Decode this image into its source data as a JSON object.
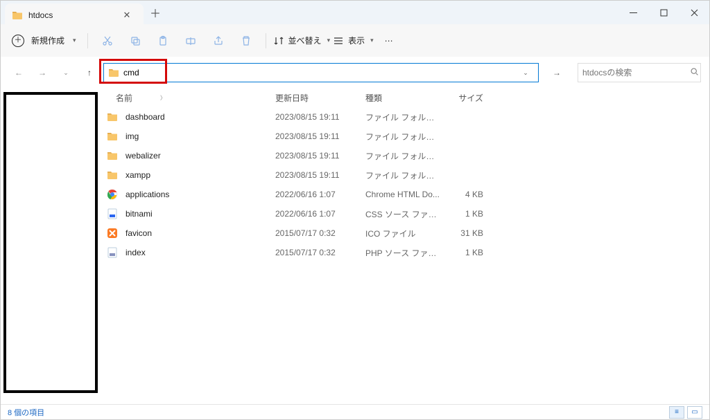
{
  "window": {
    "tab_title": "htdocs"
  },
  "toolbar": {
    "new_label": "新規作成",
    "sort_label": "並べ替え",
    "view_label": "表示"
  },
  "address": {
    "value": "cmd"
  },
  "search": {
    "placeholder": "htdocsの検索"
  },
  "columns": {
    "name": "名前",
    "date": "更新日時",
    "type": "種類",
    "size": "サイズ"
  },
  "files": [
    {
      "icon": "folder",
      "name": "dashboard",
      "date": "2023/08/15 19:11",
      "type": "ファイル フォルダー",
      "size": ""
    },
    {
      "icon": "folder",
      "name": "img",
      "date": "2023/08/15 19:11",
      "type": "ファイル フォルダー",
      "size": ""
    },
    {
      "icon": "folder",
      "name": "webalizer",
      "date": "2023/08/15 19:11",
      "type": "ファイル フォルダー",
      "size": ""
    },
    {
      "icon": "folder",
      "name": "xampp",
      "date": "2023/08/15 19:11",
      "type": "ファイル フォルダー",
      "size": ""
    },
    {
      "icon": "chrome",
      "name": "applications",
      "date": "2022/06/16 1:07",
      "type": "Chrome HTML Do...",
      "size": "4 KB"
    },
    {
      "icon": "css",
      "name": "bitnami",
      "date": "2022/06/16 1:07",
      "type": "CSS ソース ファイル",
      "size": "1 KB"
    },
    {
      "icon": "xampp",
      "name": "favicon",
      "date": "2015/07/17 0:32",
      "type": "ICO ファイル",
      "size": "31 KB"
    },
    {
      "icon": "php",
      "name": "index",
      "date": "2015/07/17 0:32",
      "type": "PHP ソース ファイル",
      "size": "1 KB"
    }
  ],
  "status": {
    "text": "8 個の項目"
  }
}
